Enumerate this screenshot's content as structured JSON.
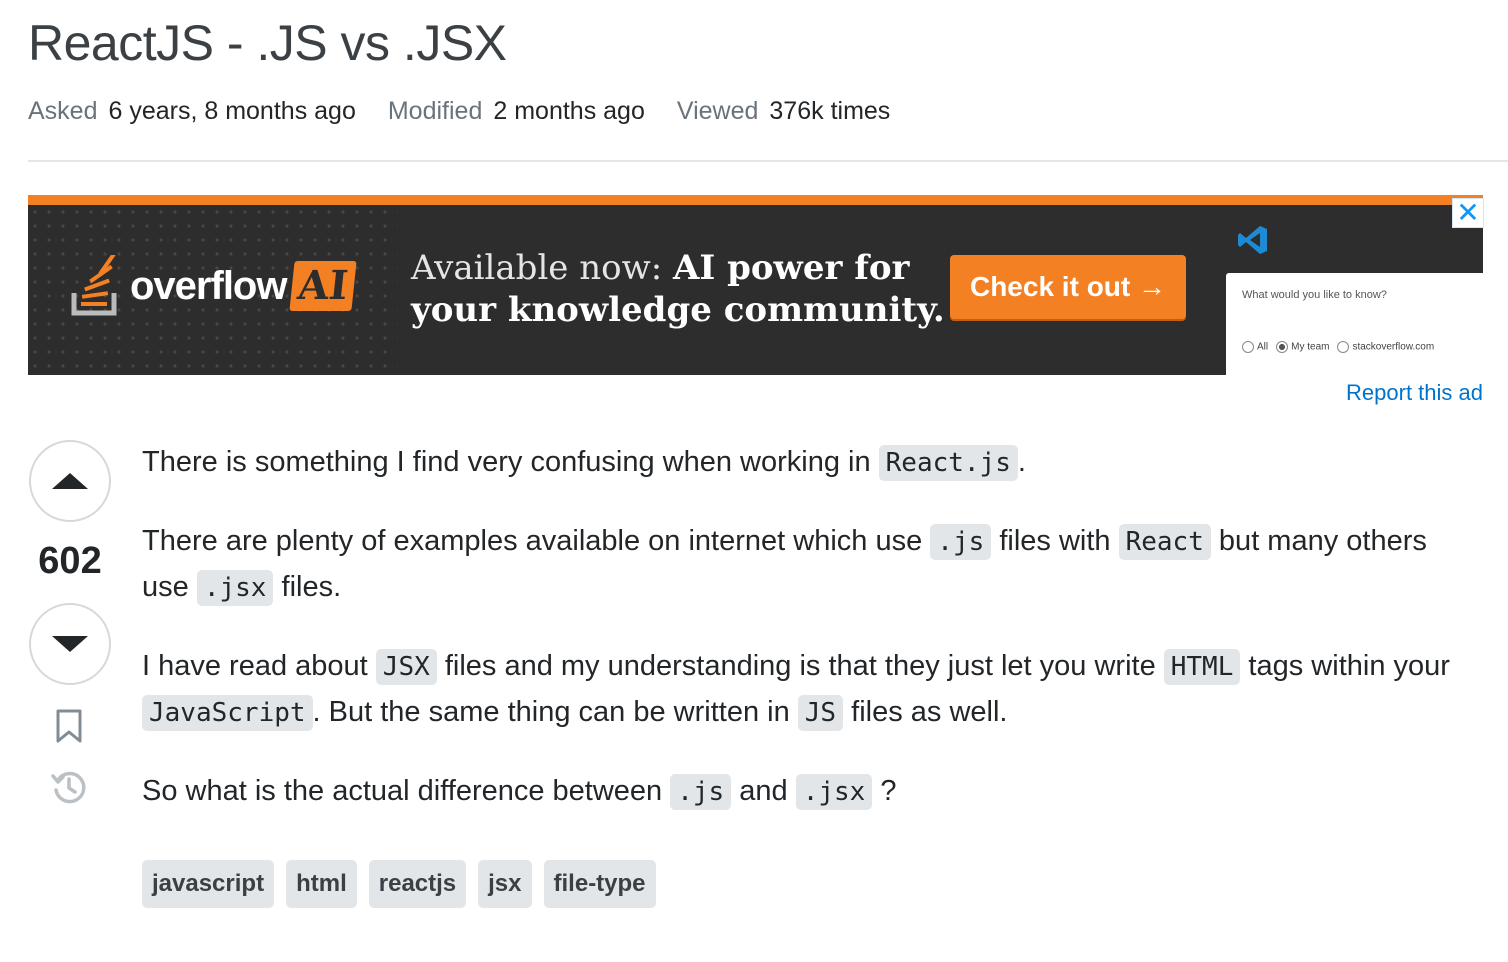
{
  "question": {
    "title": "ReactJS - .JS vs .JSX",
    "meta": [
      {
        "label": "Asked",
        "value": "6 years, 8 months ago"
      },
      {
        "label": "Modified",
        "value": "2 months ago"
      },
      {
        "label": "Viewed",
        "value": "376k times"
      }
    ],
    "score": "602",
    "body": {
      "p1": {
        "t1": "There is something I find very confusing when working in ",
        "c1": "React.js",
        "t2": "."
      },
      "p2": {
        "t1": "There are plenty of examples available on internet which use ",
        "c1": ".js",
        "t2": " files with ",
        "c2": "React",
        "t3": " but many others use ",
        "c3": ".jsx",
        "t4": " files."
      },
      "p3": {
        "t1": "I have read about ",
        "c1": "JSX",
        "t2": " files and my understanding is that they just let you write ",
        "c2": "HTML",
        "t3": " tags within your ",
        "c3": "JavaScript",
        "t4": ". But the same thing can be written in ",
        "c4": "JS",
        "t5": " files as well."
      },
      "p4": {
        "t1": "So what is the actual difference between ",
        "c1": ".js",
        "t2": " and ",
        "c2": ".jsx",
        "t3": " ?"
      }
    },
    "tags": [
      "javascript",
      "html",
      "reactjs",
      "jsx",
      "file-type"
    ]
  },
  "ad": {
    "brand_word": "overflow",
    "brand_ai": "AI",
    "headline_light": "Available now: ",
    "headline_bold_1": "AI power for",
    "headline_bold_2": "your knowledge community.",
    "cta": "Check it out →",
    "mini_question": "What would you like to know?",
    "mini_options": [
      "All",
      "My team",
      "stackoverflow.com"
    ],
    "close": "✕",
    "report": "Report this ad",
    "accent": "#f48024"
  }
}
